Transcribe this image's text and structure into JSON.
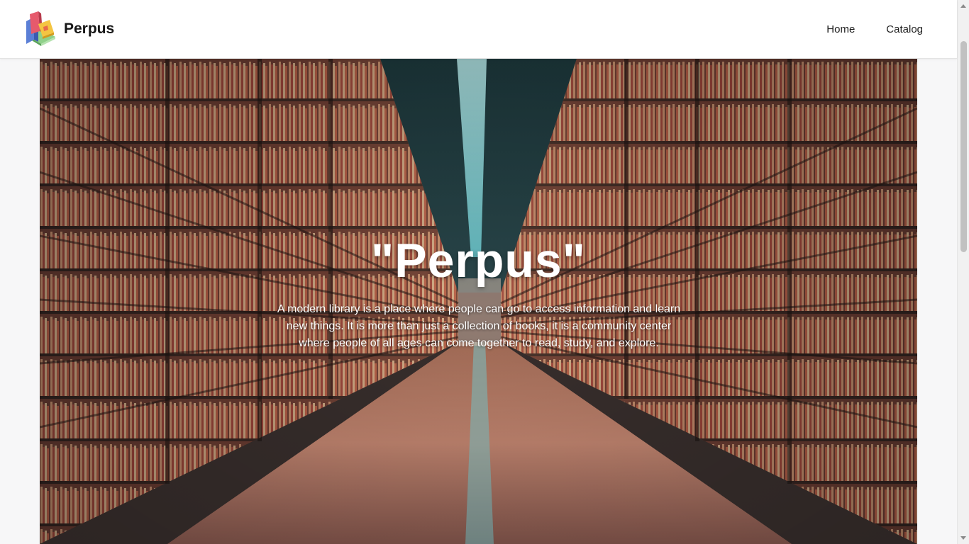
{
  "brand": {
    "name": "Perpus",
    "logo_icon": "books-stack-icon"
  },
  "nav": {
    "items": [
      {
        "label": "Home"
      },
      {
        "label": "Catalog"
      }
    ]
  },
  "hero": {
    "background": "library-bookshelves-image",
    "title": "\"Perpus\"",
    "description": "A modern library is a place where people can go to access information and learn new things. It is more than just a collection of books, it is a community center where people of all ages can come together to read, study, and explore."
  },
  "colors": {
    "navbar_bg": "#ffffff",
    "page_bg": "#f7f7f8",
    "hero_text": "#ffffff"
  }
}
